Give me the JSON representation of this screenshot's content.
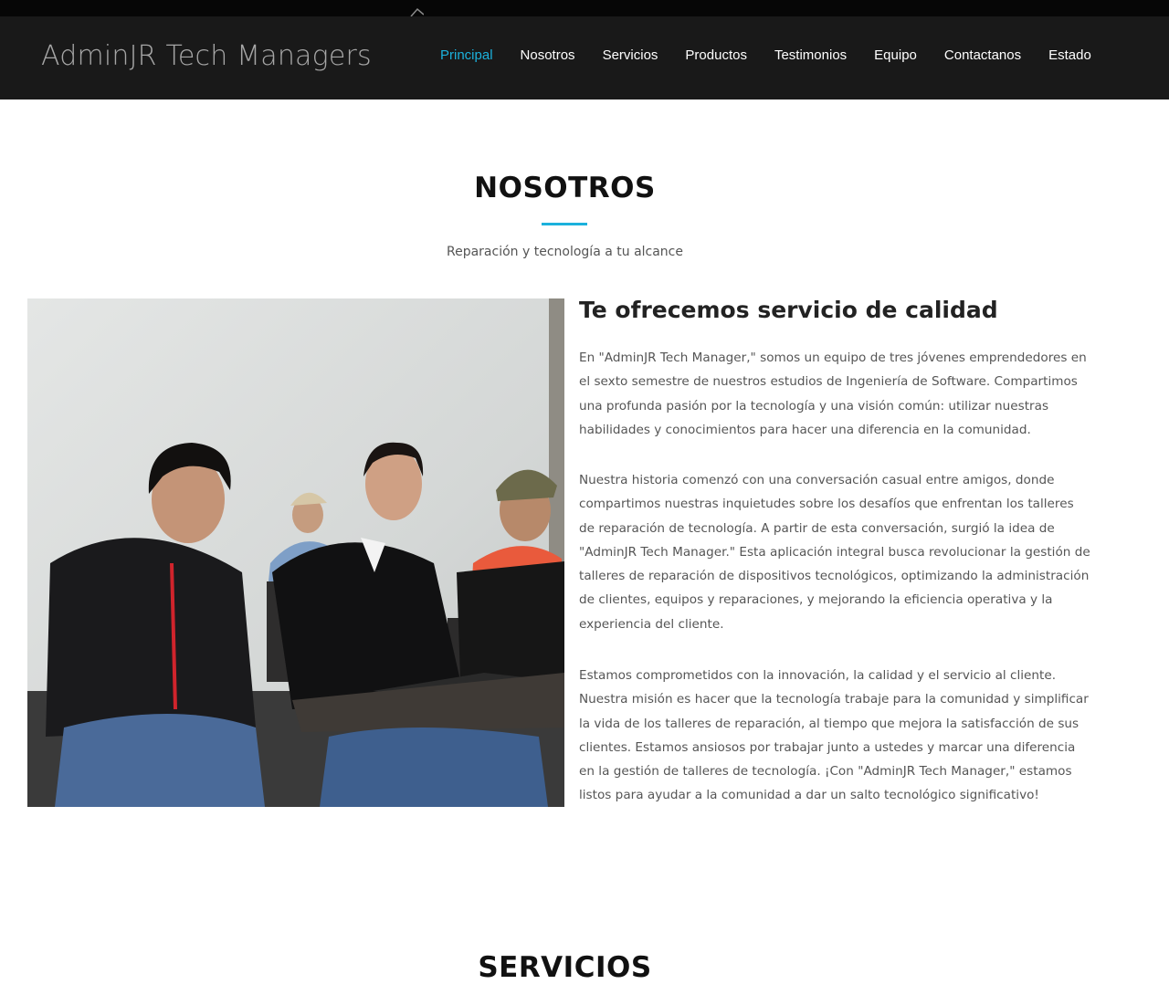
{
  "navbar": {
    "brand": "AdminJR Tech Managers",
    "items": [
      {
        "label": "Principal",
        "active": true
      },
      {
        "label": "Nosotros",
        "active": false
      },
      {
        "label": "Servicios",
        "active": false
      },
      {
        "label": "Productos",
        "active": false
      },
      {
        "label": "Testimonios",
        "active": false
      },
      {
        "label": "Equipo",
        "active": false
      },
      {
        "label": "Contactanos",
        "active": false
      },
      {
        "label": "Estado",
        "active": false
      }
    ]
  },
  "about": {
    "title": "NOSOTROS",
    "subtitle": "Reparación y tecnología a tu alcance",
    "heading": "Te ofrecemos servicio de calidad",
    "paragraphs": [
      "En \"AdminJR Tech Manager,\" somos un equipo de tres jóvenes emprendedores en el sexto semestre de nuestros estudios de Ingeniería de Software. Compartimos una profunda pasión por la tecnología y una visión común: utilizar nuestras habilidades y conocimientos para hacer una diferencia en la comunidad.",
      "Nuestra historia comenzó con una conversación casual entre amigos, donde compartimos nuestras inquietudes sobre los desafíos que enfrentan los talleres de reparación de tecnología. A partir de esta conversación, surgió la idea de \"AdminJR Tech Manager.\" Esta aplicación integral busca revolucionar la gestión de talleres de reparación de dispositivos tecnológicos, optimizando la administración de clientes, equipos y reparaciones, y mejorando la eficiencia operativa y la experiencia del cliente.",
      "Estamos comprometidos con la innovación, la calidad y el servicio al cliente. Nuestra misión es hacer que la tecnología trabaje para la comunidad y simplificar la vida de los talleres de reparación, al tiempo que mejora la satisfacción de sus clientes. Estamos ansiosos por trabajar junto a ustedes y marcar una diferencia en la gestión de talleres de tecnología. ¡Con \"AdminJR Tech Manager,\" estamos listos para ayudar a la comunidad a dar un salto tecnológico significativo!"
    ]
  },
  "services": {
    "title": "SERVICIOS"
  },
  "colors": {
    "accent": "#1bb1dc",
    "navbar_bg": "#191919",
    "heading": "#111111",
    "body_text": "#555555"
  }
}
